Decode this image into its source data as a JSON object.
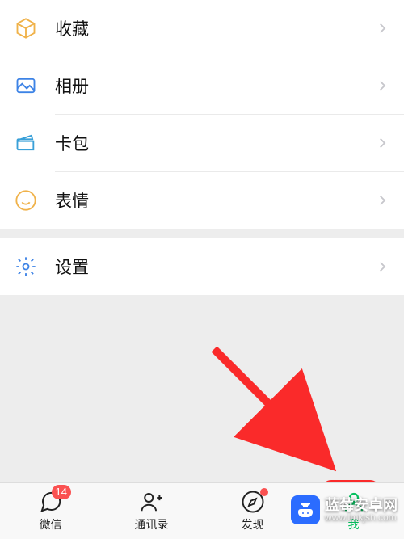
{
  "menu": {
    "group1": [
      {
        "id": "favorites",
        "label": "收藏",
        "icon": "cube",
        "color": "#f0b24a"
      },
      {
        "id": "album",
        "label": "相册",
        "icon": "photo",
        "color": "#3d83e6"
      },
      {
        "id": "cards",
        "label": "卡包",
        "icon": "wallet",
        "color": "#3aa0d8"
      },
      {
        "id": "stickers",
        "label": "表情",
        "icon": "smile",
        "color": "#f0b24a"
      }
    ],
    "group2": [
      {
        "id": "settings",
        "label": "设置",
        "icon": "gear",
        "color": "#3d83e6"
      }
    ]
  },
  "tabs": [
    {
      "id": "chats",
      "label": "微信",
      "icon": "chat",
      "badge": "14"
    },
    {
      "id": "contacts",
      "label": "通讯录",
      "icon": "contact"
    },
    {
      "id": "discover",
      "label": "发现",
      "icon": "compass",
      "dot": true
    },
    {
      "id": "me",
      "label": "我",
      "icon": "person",
      "active": true
    }
  ],
  "annotation": {
    "highlight_tab": "me"
  },
  "watermark": {
    "title": "蓝莓安卓网",
    "sub": "www.lmkjsh.com"
  }
}
